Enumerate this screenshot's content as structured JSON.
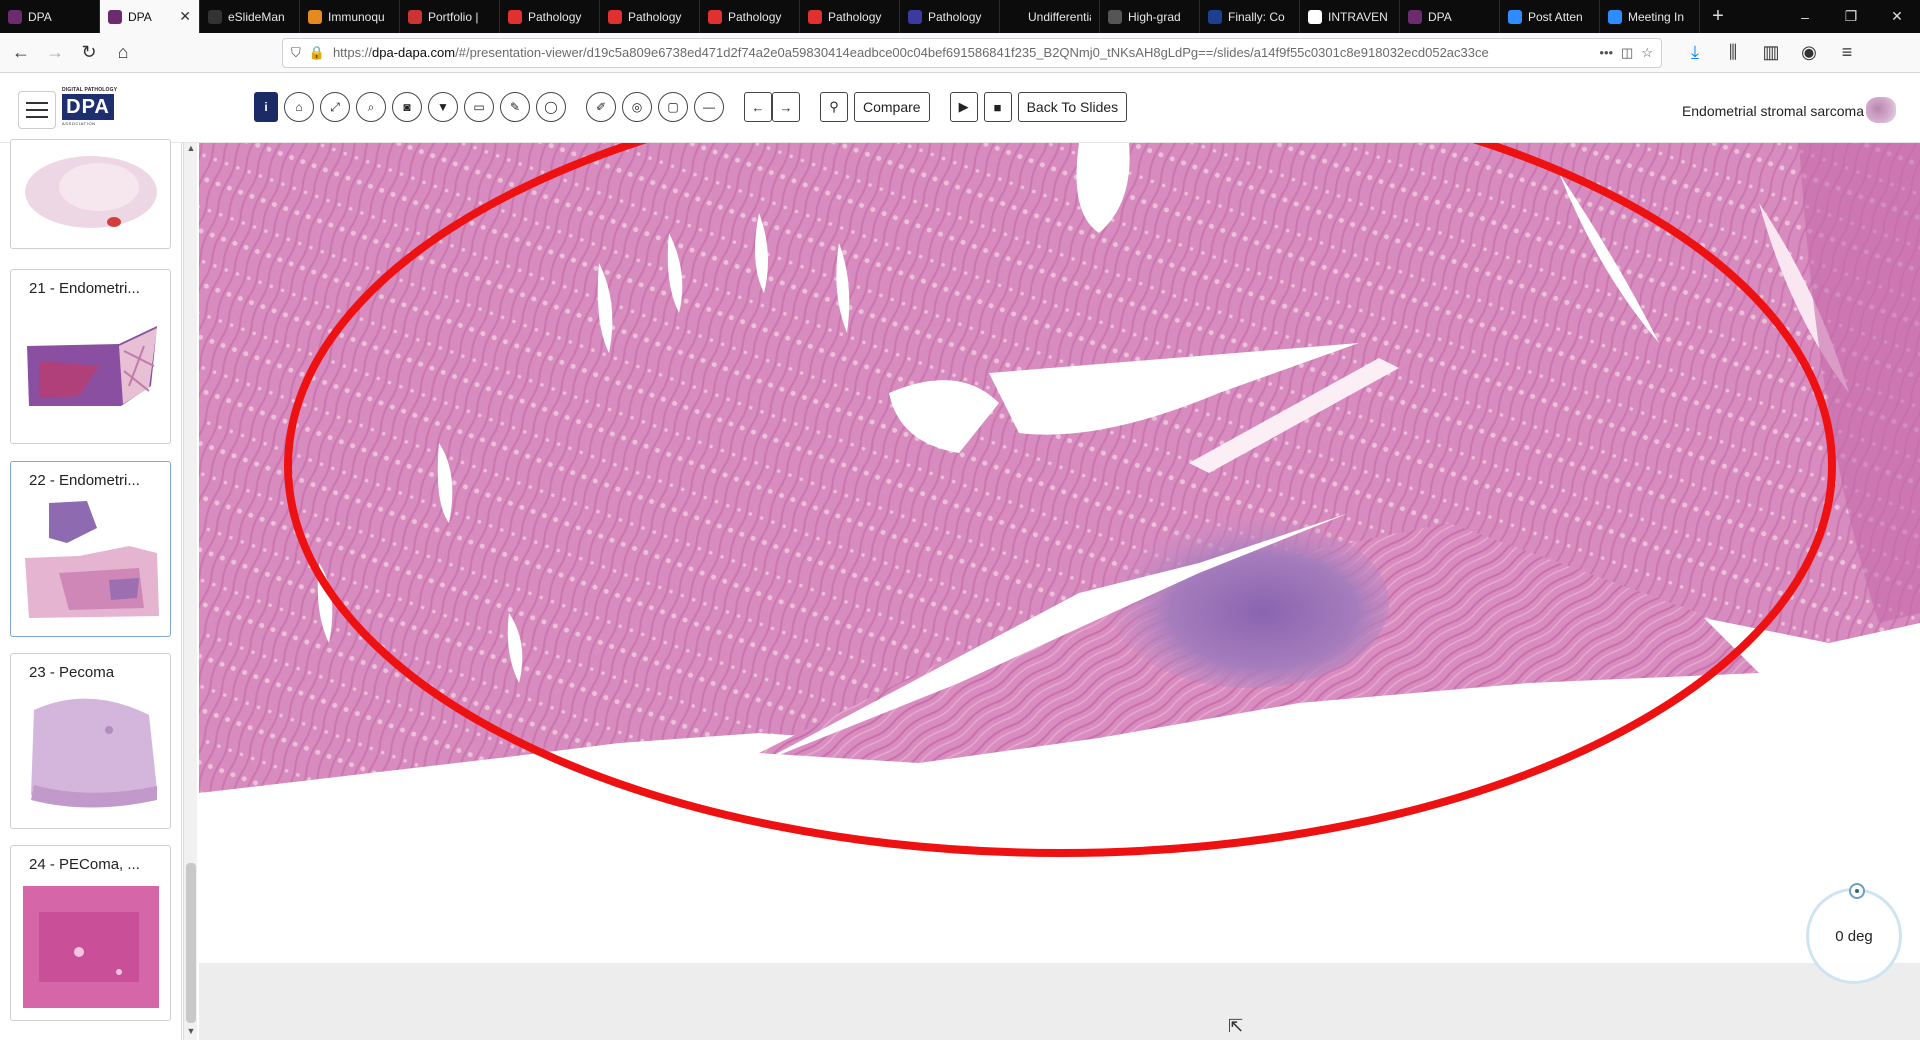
{
  "browser": {
    "tabs": [
      {
        "title": "DPA",
        "color": "#6b2b6d"
      },
      {
        "title": "DPA",
        "color": "#6b2b6d",
        "active": true
      },
      {
        "title": "eSlideMan",
        "color": "#333"
      },
      {
        "title": "Immunoqu",
        "color": "#e58a1f"
      },
      {
        "title": "Portfolio |",
        "color": "#c33"
      },
      {
        "title": "Pathology",
        "color": "#e03030"
      },
      {
        "title": "Pathology",
        "color": "#e03030"
      },
      {
        "title": "Pathology",
        "color": "#e03030"
      },
      {
        "title": "Pathology",
        "color": "#e03030"
      },
      {
        "title": "Pathology",
        "color": "#3a3aa0"
      },
      {
        "title": "Undifferentiate",
        "color": "#0c0c0d"
      },
      {
        "title": "High-grad",
        "color": "#555"
      },
      {
        "title": "Finally: Co",
        "color": "#1d3f8f"
      },
      {
        "title": "INTRAVEN",
        "color": "#ffffff"
      },
      {
        "title": "DPA",
        "color": "#6b2b6d"
      },
      {
        "title": "Post Atten",
        "color": "#2d8cff"
      },
      {
        "title": "Meeting In",
        "color": "#2d8cff"
      }
    ],
    "url_host": "dpa-dapa.com",
    "url_prefix": "https://",
    "url_path": "/#/presentation-viewer/d19c5a809e6738ed471d2f74a2e0a59830414eadbce00c04bef691586841f235_B2QNmj0_tNKsAH8gLdPg==/slides/a14f9f55c0301c8e918032ecd052ac33ce",
    "url_more": "•••"
  },
  "header": {
    "logo_top": "DIGITAL PATHOLOGY",
    "logo_main": "DPA",
    "logo_sub": "ASSOCIATION",
    "compare_label": "Compare",
    "back_label": "Back To Slides",
    "slide_title": "Endometrial stromal sarcoma"
  },
  "sidebar": {
    "cards": [
      {
        "label": "",
        "thumb": "pale-round"
      },
      {
        "label": "21 - Endometri...",
        "thumb": "purple-block"
      },
      {
        "label": "22 - Endometri...",
        "thumb": "two-fragments",
        "selected": true
      },
      {
        "label": "23 - Pecoma",
        "thumb": "lilac-dome"
      },
      {
        "label": "24 - PEComa, ...",
        "thumb": "pink-square"
      }
    ]
  },
  "viewer": {
    "rotation_label": "0 deg",
    "annotation": "red-ellipse"
  },
  "colors": {
    "tissue": "#d88cbf",
    "tissue_dark": "#c871ad",
    "tumor_purple": "#8d6db3",
    "annotation": "#ee1111",
    "brand_navy": "#1d2f6f"
  }
}
